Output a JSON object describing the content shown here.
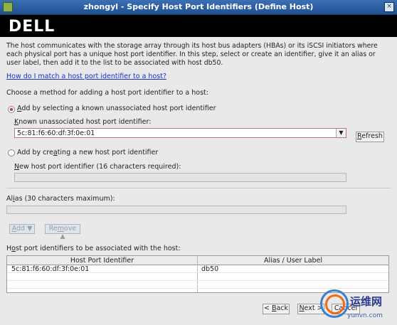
{
  "window": {
    "title": "zhongyl - Specify Host Port Identifiers (Define Host)"
  },
  "banner": {
    "logo": "DELL"
  },
  "intro": {
    "text": "The host communicates with the storage array through its host bus adapters (HBAs) or its iSCSI initiators where each physical port has a unique host port identifier. In this step, select or create an identifier, give it an alias or user label, then add it to the list to be associated with host db50.",
    "help_link": "How do I match a host port identifier to a host?"
  },
  "method": {
    "heading": "Choose a method for adding a host port identifier to a host:",
    "option_known": {
      "label_pre": "",
      "label_mn": "A",
      "label_post": "dd by selecting a known unassociated host port identifier",
      "selected": true
    },
    "known_field": {
      "label_mn": "K",
      "label_post": "nown unassociated host port identifier:",
      "value": "5c:81:f6:60:df:3f:0e:01",
      "refresh_mn": "R",
      "refresh_post": "efresh"
    },
    "option_new": {
      "label_pre": "Add by cre",
      "label_mn": "a",
      "label_post": "ting a new host port identifier",
      "selected": false
    },
    "new_field": {
      "label_mn": "N",
      "label_post": "ew host port identifier (16 characters required):",
      "value": ""
    }
  },
  "alias": {
    "label_pre": "Al",
    "label_mn": "i",
    "label_post": "as (30 characters maximum):",
    "value": ""
  },
  "actions": {
    "add_mn": "A",
    "add_post": "dd",
    "remove_pre": "Re",
    "remove_mn": "m",
    "remove_post": "ove"
  },
  "list": {
    "heading_pre": "H",
    "heading_mn": "o",
    "heading_post": "st port identifiers to be associated with the host:",
    "columns": [
      "Host Port Identifier",
      "Alias / User Label"
    ],
    "rows": [
      {
        "identifier": "5c:81:f6:60:df:3f:0e:01",
        "alias": "db50"
      }
    ]
  },
  "footer": {
    "back_pre": "< ",
    "back_mn": "B",
    "back_post": "ack",
    "next_mn": "N",
    "next_post": "ext >",
    "cancel": "Cancel"
  },
  "watermark": {
    "line1": "运维网",
    "line2": "yunvn.com"
  }
}
